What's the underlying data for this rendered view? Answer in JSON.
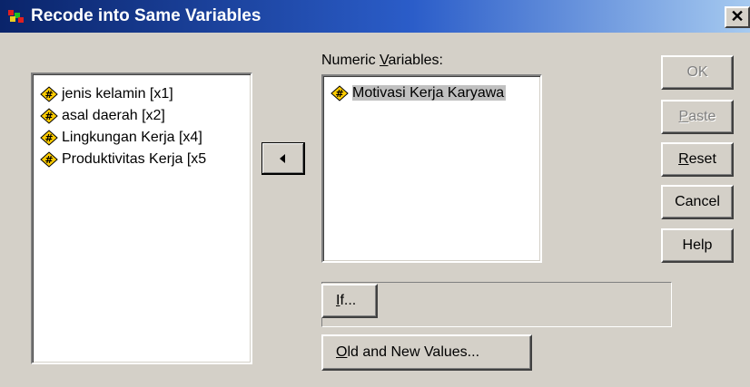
{
  "window": {
    "title": "Recode into Same Variables",
    "close_glyph": "✕",
    "icon": "spss-app-icon"
  },
  "source_list": {
    "items": [
      {
        "label": "jenis kelamin [x1]",
        "icon": "numeric-variable-icon"
      },
      {
        "label": "asal daerah [x2]",
        "icon": "numeric-variable-icon"
      },
      {
        "label": "Lingkungan Kerja [x4]",
        "icon": "numeric-variable-icon"
      },
      {
        "label": "Produktivitas Kerja [x5",
        "icon": "numeric-variable-icon"
      }
    ]
  },
  "transfer_button": {
    "icon": "arrow-left-icon"
  },
  "numeric_variables": {
    "label_before": "Numeric ",
    "label_underlined": "V",
    "label_after": "ariables:",
    "items": [
      {
        "label": "Motivasi Kerja Karyawa",
        "icon": "numeric-variable-icon",
        "selected": true
      }
    ]
  },
  "buttons": {
    "ok": "OK",
    "paste_u": "P",
    "paste_rest": "aste",
    "reset_u": "R",
    "reset_rest": "eset",
    "cancel": "Cancel",
    "help": "Help"
  },
  "if_button": {
    "u": "I",
    "rest": "f..."
  },
  "old_new_button": {
    "u": "O",
    "rest": "ld and New Values..."
  },
  "colors": {
    "dialog_face": "#d4d0c8",
    "title_start": "#0a246a",
    "title_end": "#a6caf0",
    "selection": "#c0c0c0",
    "variable_icon": "#ffcc00"
  }
}
